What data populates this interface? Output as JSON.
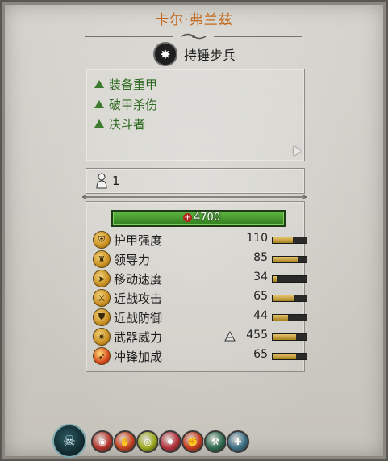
{
  "header": {
    "unit_name": "卡尔·弗兰兹",
    "unit_type": "持锤步兵",
    "unit_type_icon": "star-burst-icon"
  },
  "traits": [
    {
      "label": "装备重甲",
      "icon": "up-triangle-icon"
    },
    {
      "label": "破甲杀伤",
      "icon": "up-triangle-icon"
    },
    {
      "label": "决斗者",
      "icon": "up-triangle-icon"
    }
  ],
  "unit_count": {
    "value": "1",
    "icon": "person-icon"
  },
  "health": {
    "value": "4700",
    "fill_fraction": 1.0
  },
  "stats": [
    {
      "name": "护甲强度",
      "value": "110",
      "fill": 0.6,
      "icon": "armor-icon"
    },
    {
      "name": "领导力",
      "value": "85",
      "fill": 0.75,
      "icon": "leadership-icon"
    },
    {
      "name": "移动速度",
      "value": "34",
      "fill": 0.15,
      "icon": "speed-icon"
    },
    {
      "name": "近战攻击",
      "value": "65",
      "fill": 0.65,
      "icon": "melee-attack-icon"
    },
    {
      "name": "近战防御",
      "value": "44",
      "fill": 0.45,
      "icon": "melee-defence-icon"
    },
    {
      "name": "武器威力",
      "value": "455",
      "fill": 0.7,
      "icon": "weapon-strength-icon"
    },
    {
      "name": "冲锋加成",
      "value": "65",
      "fill": 0.7,
      "icon": "charge-bonus-icon"
    }
  ],
  "abilities": [
    {
      "icon": "unit-portrait-icon",
      "color": "#1f4a52"
    },
    {
      "icon": "beast-face-icon",
      "color": "#b4342a"
    },
    {
      "icon": "paw-icon",
      "color": "#c7421f"
    },
    {
      "icon": "eye-icon",
      "color": "#9aa81a"
    },
    {
      "icon": "monster-icon",
      "color": "#b3313a"
    },
    {
      "icon": "hand-icon",
      "color": "#c13a1e"
    },
    {
      "icon": "hammer-strike-icon",
      "color": "#2f6b4f"
    },
    {
      "icon": "shield-cross-icon",
      "color": "#3d6f86"
    }
  ]
}
